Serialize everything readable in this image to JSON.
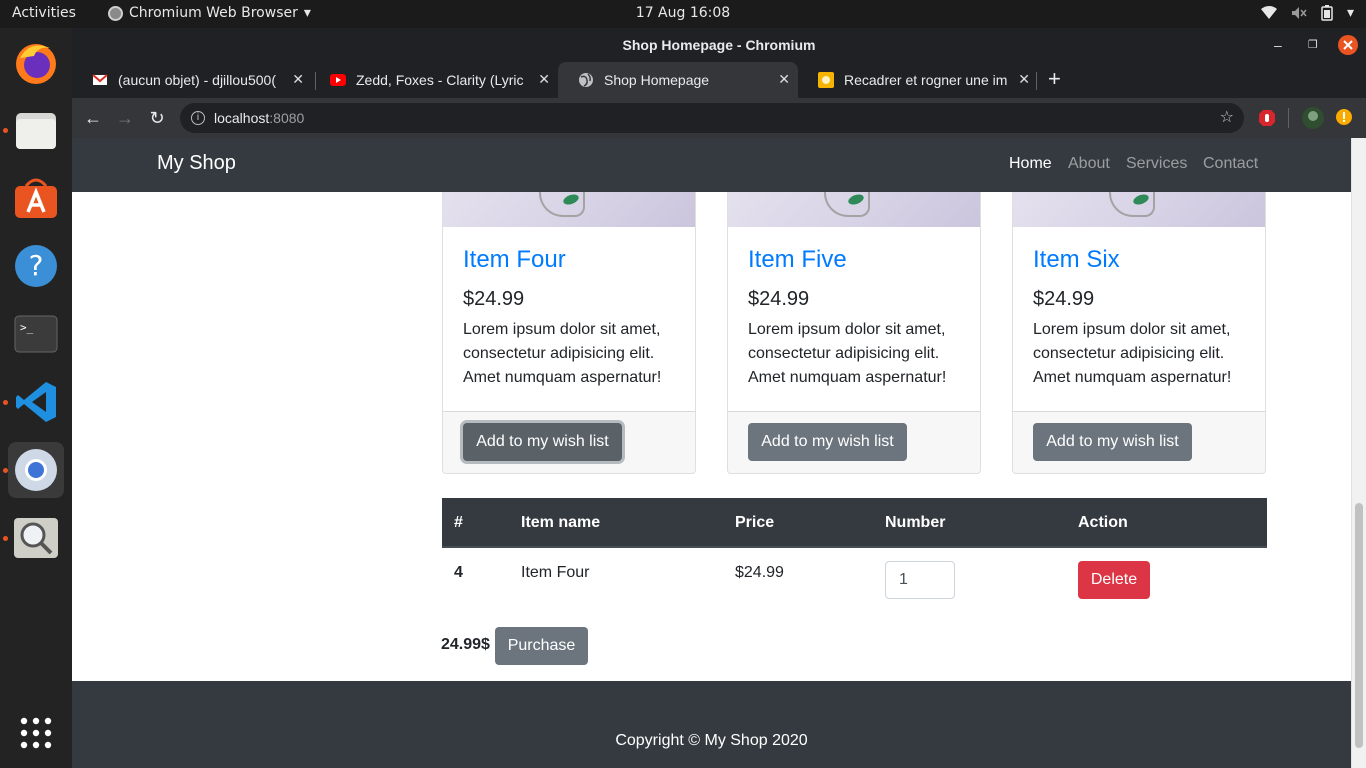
{
  "os": {
    "activities": "Activities",
    "app_menu": "Chromium Web Browser",
    "clock": "17 Aug  16:08"
  },
  "browser": {
    "window_title": "Shop Homepage - Chromium",
    "tabs": [
      {
        "title": "(aucun objet) - djillou500(",
        "icon": "gmail-icon"
      },
      {
        "title": "Zedd, Foxes - Clarity (Lyric",
        "icon": "youtube-icon"
      },
      {
        "title": "Shop Homepage",
        "icon": "globe-icon",
        "active": true
      },
      {
        "title": "Recadrer et rogner une im",
        "icon": "image-editor-icon"
      }
    ],
    "url_host": "localhost",
    "url_port": ":8080"
  },
  "site": {
    "brand": "My Shop",
    "nav": [
      "Home",
      "About",
      "Services",
      "Contact"
    ],
    "products": [
      {
        "name": "Item Four",
        "price": "$24.99",
        "description": "Lorem ipsum dolor sit amet, consectetur adipisicing elit. Amet numquam aspernatur!",
        "button": "Add to my wish list"
      },
      {
        "name": "Item Five",
        "price": "$24.99",
        "description": "Lorem ipsum dolor sit amet, consectetur adipisicing elit. Amet numquam aspernatur!",
        "button": "Add to my wish list"
      },
      {
        "name": "Item Six",
        "price": "$24.99",
        "description": "Lorem ipsum dolor sit amet, consectetur adipisicing elit. Amet numquam aspernatur!",
        "button": "Add to my wish list"
      }
    ],
    "cart": {
      "headers": [
        "#",
        "Item name",
        "Price",
        "Number",
        "Action"
      ],
      "rows": [
        {
          "id": "4",
          "name": "Item Four",
          "price": "$24.99",
          "number": "1",
          "action": "Delete"
        }
      ],
      "total": "24.99$",
      "purchase": "Purchase"
    },
    "footer": "Copyright © My Shop 2020"
  },
  "colors": {
    "navbar_bg": "#343a40",
    "link_primary": "#007bff",
    "btn_secondary": "#6c757d",
    "btn_danger": "#dc3545",
    "ubuntu_orange": "#e95420"
  }
}
